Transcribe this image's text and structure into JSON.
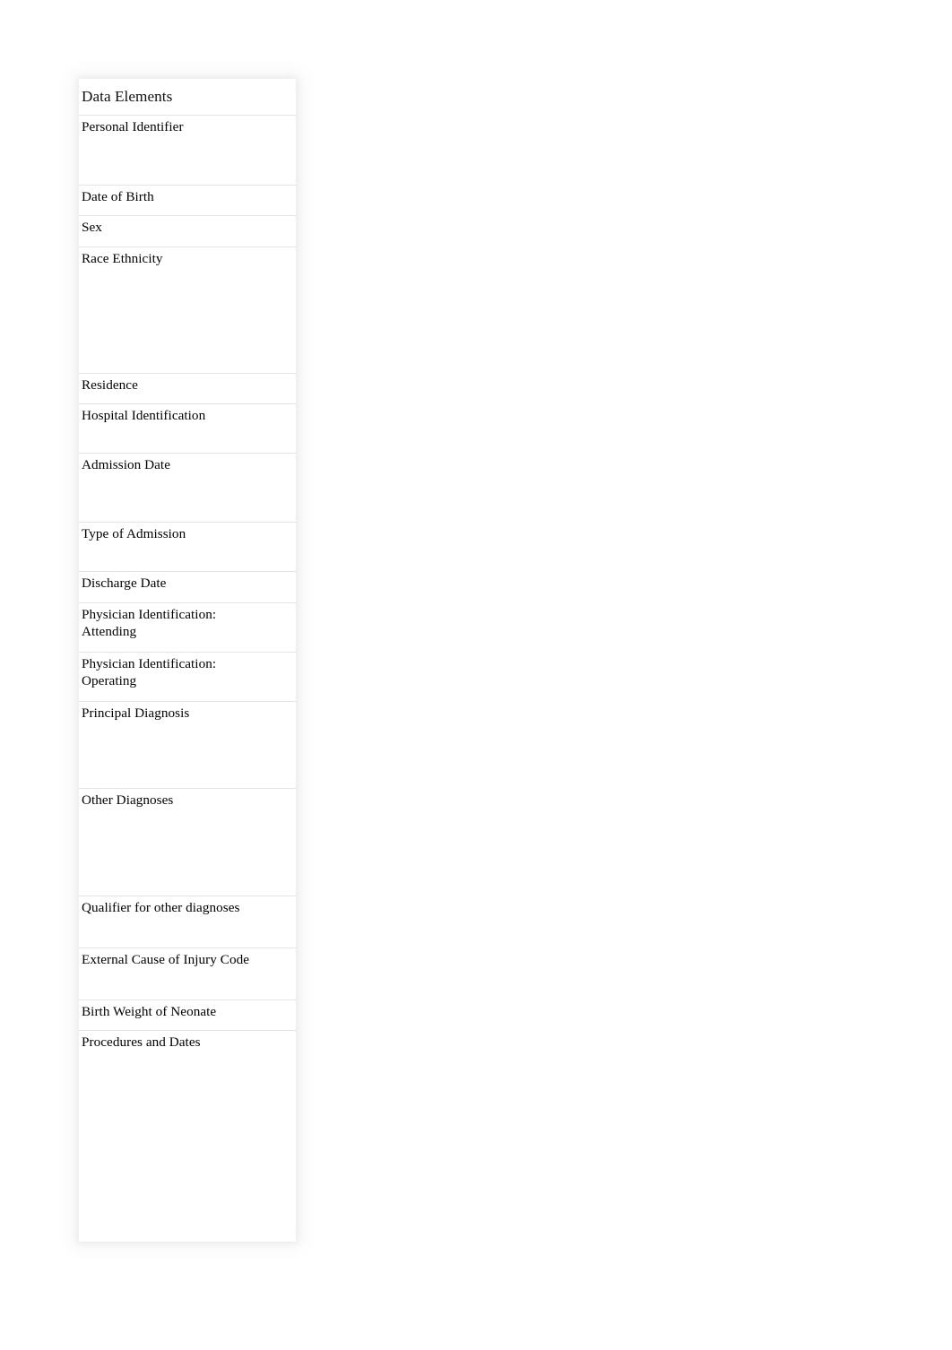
{
  "document": {
    "background_color": "#ffffff",
    "text_color": "#000000",
    "border_color": "#e3e3e3"
  },
  "table": {
    "name": "Data Elements table",
    "header": {
      "label": "Data Elements"
    },
    "rows": [
      {
        "label": "Personal Identifier"
      },
      {
        "label": "Date of Birth"
      },
      {
        "label": "Sex"
      },
      {
        "label": "Race Ethnicity"
      },
      {
        "label": "Residence"
      },
      {
        "label": "Hospital Identification"
      },
      {
        "label": "Admission Date"
      },
      {
        "label": "Type of Admission"
      },
      {
        "label": "Discharge Date"
      },
      {
        "label": "Physician Identification:\nAttending"
      },
      {
        "label": "Physician Identification:\nOperating"
      },
      {
        "label": "Principal Diagnosis"
      },
      {
        "label": "Other Diagnoses"
      },
      {
        "label": "Qualifier for other diagnoses"
      },
      {
        "label": "External Cause of Injury Code"
      },
      {
        "label": "Birth Weight of Neonate"
      },
      {
        "label": "Procedures and Dates"
      }
    ]
  }
}
